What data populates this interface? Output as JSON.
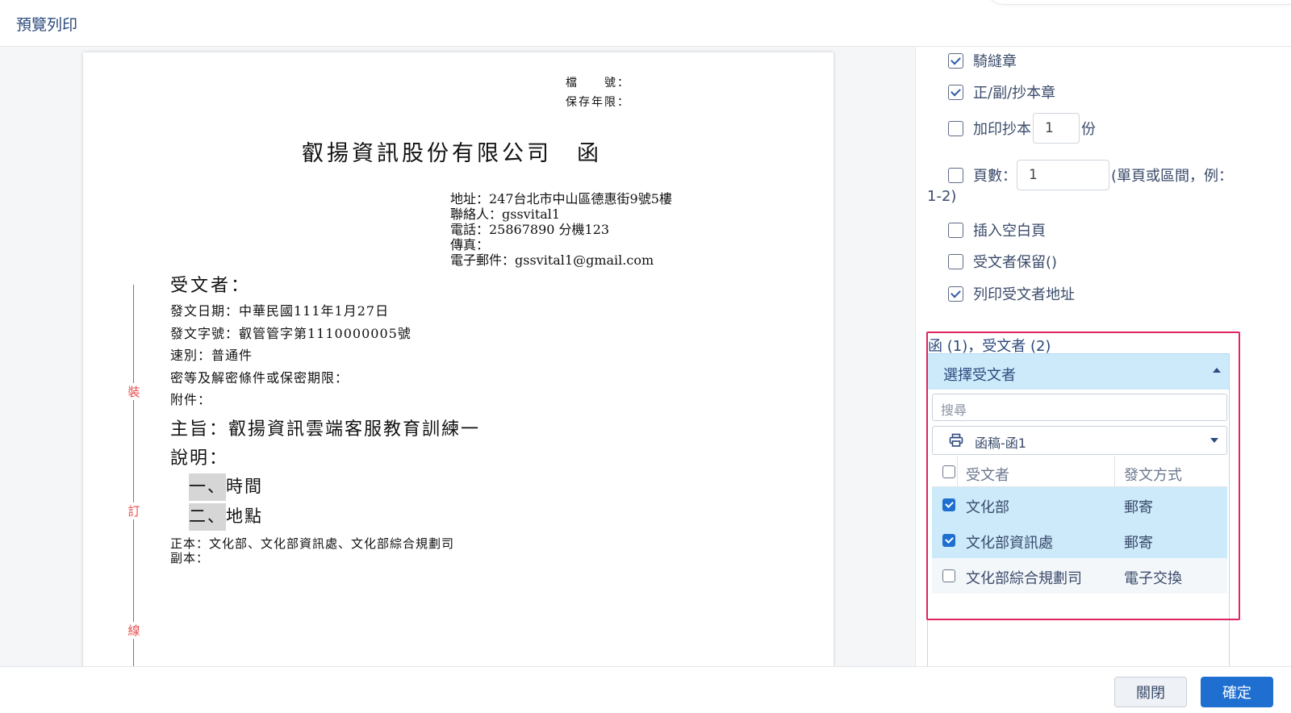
{
  "header": {
    "title": "預覽列印"
  },
  "document": {
    "file_no_label": "檔　　號：",
    "retention_label": "保存年限：",
    "company": "叡揚資訊股份有限公司　函",
    "address": "地址：247台北市中山區德惠街9號5樓",
    "contact": "聯絡人：gssvital1",
    "phone": "電話：25867890 分機123",
    "fax": "傳真：",
    "email": "電子郵件：gssvital1@gmail.com",
    "recipient": "受文者：",
    "date": "發文日期：中華民國111年1月27日",
    "doc_no": "發文字號：叡管管字第1110000005號",
    "speed": "速別：普通件",
    "secret": "密等及解密條件或保密期限：",
    "attachment": "附件：",
    "subject": "主旨：叡揚資訊雲端客服教育訓練一",
    "explain": "說明：",
    "items": [
      {
        "num": "一、",
        "text": "時間"
      },
      {
        "num": "二、",
        "text": "地點"
      }
    ],
    "main_copy": "正本：文化部、文化部資訊處、文化部綜合規劃司",
    "sub_copy": "副本：",
    "binding": [
      "裝",
      "訂",
      "線"
    ]
  },
  "options": {
    "seam_seal": {
      "label": "騎縫章",
      "checked": true
    },
    "copy_seal": {
      "label": "正/副/抄本章",
      "checked": true
    },
    "extra_copies": {
      "label": "加印抄本",
      "value": "1",
      "unit": "份",
      "checked": false
    },
    "pages": {
      "label": "頁數：",
      "value": "1",
      "hint": "(單頁或區間，例：",
      "hint2": "1-2)",
      "checked": false
    },
    "blank_page": {
      "label": "插入空白頁",
      "checked": false
    },
    "keep_recipient": {
      "label": "受文者保留()",
      "checked": false
    },
    "print_address": {
      "label": "列印受文者地址",
      "checked": true
    }
  },
  "recipients_panel": {
    "count_label": "函 (1)，受文者 (2)",
    "title": "選擇受文者",
    "search_placeholder": "搜尋",
    "draft_select": "函稿-函1",
    "columns": {
      "name": "受文者",
      "method": "發文方式"
    },
    "rows": [
      {
        "name": "文化部",
        "method": "郵寄",
        "checked": true
      },
      {
        "name": "文化部資訊處",
        "method": "郵寄",
        "checked": true
      },
      {
        "name": "文化部綜合規劃司",
        "method": "電子交換",
        "checked": false
      }
    ]
  },
  "footer": {
    "close_label": "關閉",
    "ok_label": "確定"
  },
  "colors": {
    "primary": "#1f6fd1",
    "highlight": "#e0245e",
    "selected_row": "#cceafa",
    "binding_line": "#e74c4c"
  }
}
